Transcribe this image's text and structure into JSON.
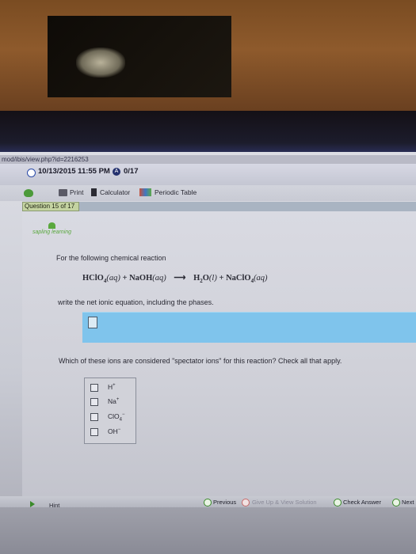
{
  "browser": {
    "url": "mod/ibis/view.php?id=2216253"
  },
  "assignment": {
    "datetime": "10/13/2015 11:55 PM",
    "score": "0/17"
  },
  "toolbar": {
    "print_label": "Print",
    "calculator_label": "Calculator",
    "periodic_table_label": "Periodic Table"
  },
  "question_tab": "Question 15 of 17",
  "logo_text": "sapling learning",
  "question": {
    "intro": "For the following chemical reaction",
    "reaction": {
      "reactant1": "HClO",
      "reactant1_sub": "4",
      "reactant1_phase": "(aq)",
      "plus1": "+",
      "reactant2": "NaOH",
      "reactant2_phase": "(aq)",
      "arrow": "⟶",
      "product1_a": "H",
      "product1_sub": "2",
      "product1_b": "O",
      "product1_phase": "(l)",
      "plus2": "+",
      "product2": "NaClO",
      "product2_sub": "4",
      "product2_phase": "(aq)"
    },
    "instruction": "write the net ionic equation, including the phases.",
    "spectator_prompt": "Which of these ions are considered \"spectator ions\" for this reaction? Check all that apply."
  },
  "options": [
    {
      "label": "H",
      "sup": "+"
    },
    {
      "label": "Na",
      "sup": "+"
    },
    {
      "label": "ClO",
      "sub": "4",
      "sup": "−"
    },
    {
      "label": "OH",
      "sup": "−"
    }
  ],
  "bottom_bar": {
    "hint": "Hint",
    "previous": "Previous",
    "give_up": "Give Up & View Solution",
    "check_answer": "Check Answer",
    "next": "Next"
  },
  "colors": {
    "answer_field": "#7fc4ec",
    "tab": "#c4d3a1",
    "accent_green": "#3a8a2a"
  }
}
